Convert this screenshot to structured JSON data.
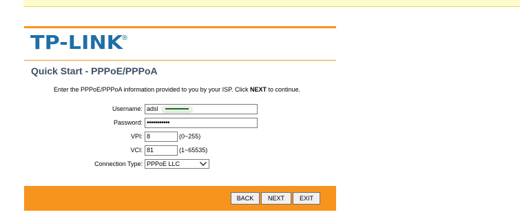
{
  "brand": {
    "logo_text": "TP-LINK",
    "registered_mark": "®",
    "accent_color": "#f7941d",
    "logo_color": "#1f6ea7"
  },
  "page": {
    "title": "Quick Start - PPPoE/PPPoA",
    "intro_before": "Enter the PPPoE/PPPoA information provided to you by your ISP. Click ",
    "intro_bold": "NEXT",
    "intro_after": " to continue."
  },
  "form": {
    "username": {
      "label": "Username:",
      "value": "adsl"
    },
    "password": {
      "label": "Password:",
      "value": "•••••••••••"
    },
    "vpi": {
      "label": "VPI:",
      "value": "8",
      "hint": "(0~255)"
    },
    "vci": {
      "label": "VCI:",
      "value": "81",
      "hint": "(1~65535)"
    },
    "connection_type": {
      "label": "Connection Type:",
      "selected": "PPPoE LLC"
    }
  },
  "buttons": {
    "back": "BACK",
    "next": "NEXT",
    "exit": "EXIT"
  },
  "icons": {
    "select_arrow": "chevron-down-icon"
  }
}
